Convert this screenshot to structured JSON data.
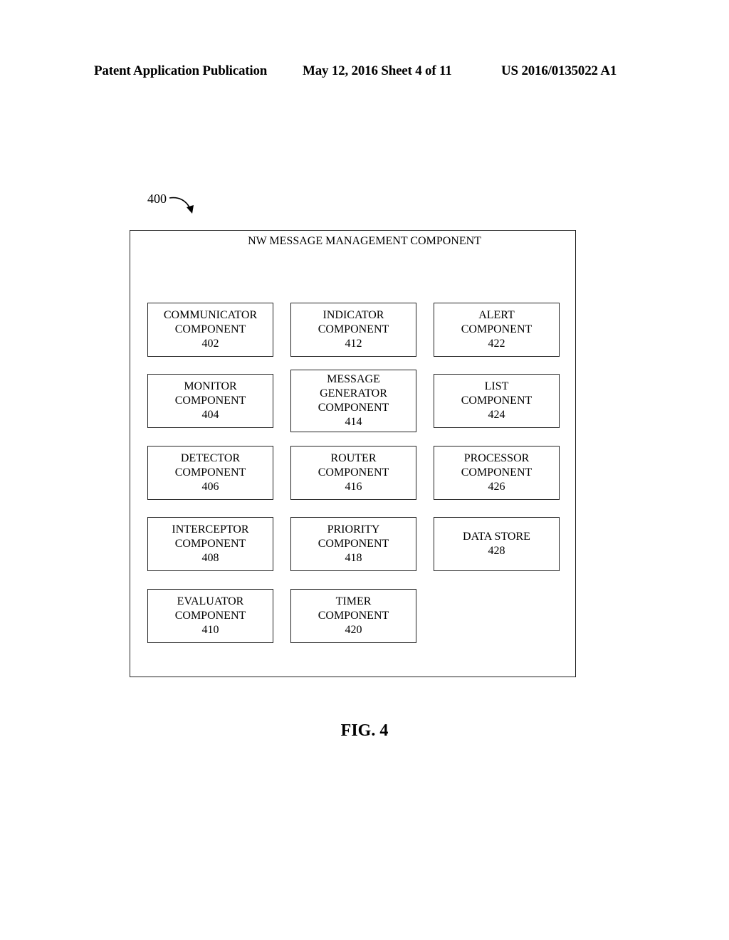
{
  "header": {
    "left": "Patent Application Publication",
    "middle": "May 12, 2016  Sheet 4 of 11",
    "right": "US 2016/0135022 A1"
  },
  "diagram": {
    "reference": "400",
    "container_title": "NW MESSAGE MANAGEMENT COMPONENT",
    "components": [
      {
        "lines": [
          "COMMUNICATOR",
          "COMPONENT"
        ],
        "number": "402"
      },
      {
        "lines": [
          "MONITOR",
          "COMPONENT"
        ],
        "number": "404"
      },
      {
        "lines": [
          "DETECTOR",
          "COMPONENT"
        ],
        "number": "406"
      },
      {
        "lines": [
          "INTERCEPTOR",
          "COMPONENT"
        ],
        "number": "408"
      },
      {
        "lines": [
          "EVALUATOR",
          "COMPONENT"
        ],
        "number": "410"
      },
      {
        "lines": [
          "INDICATOR",
          "COMPONENT"
        ],
        "number": "412"
      },
      {
        "lines": [
          "MESSAGE",
          "GENERATOR",
          "COMPONENT"
        ],
        "number": "414"
      },
      {
        "lines": [
          "ROUTER",
          "COMPONENT"
        ],
        "number": "416"
      },
      {
        "lines": [
          "PRIORITY",
          "COMPONENT"
        ],
        "number": "418"
      },
      {
        "lines": [
          "TIMER",
          "COMPONENT"
        ],
        "number": "420"
      },
      {
        "lines": [
          "ALERT",
          "COMPONENT"
        ],
        "number": "422"
      },
      {
        "lines": [
          "LIST",
          "COMPONENT"
        ],
        "number": "424"
      },
      {
        "lines": [
          "PROCESSOR",
          "COMPONENT"
        ],
        "number": "426"
      },
      {
        "lines": [
          "DATA STORE"
        ],
        "number": "428"
      }
    ]
  },
  "figure_label": "FIG. 4"
}
